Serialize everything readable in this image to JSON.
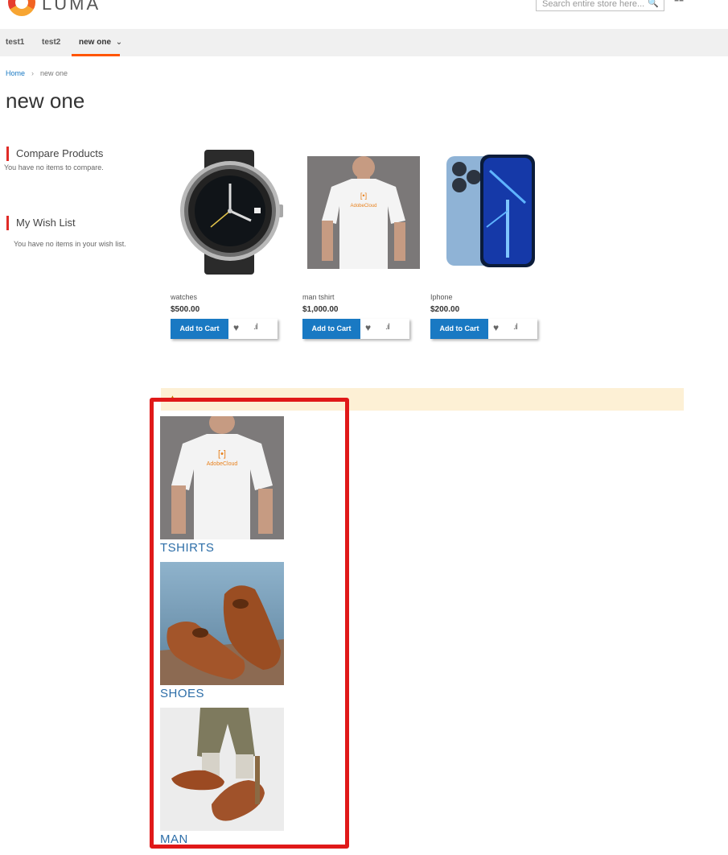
{
  "header": {
    "logo_text": "LUMA",
    "search_placeholder": "Search entire store here...",
    "minicart_icon": "cart-icon"
  },
  "nav": {
    "items": [
      "test1",
      "test2",
      "new one"
    ],
    "active_index": 2
  },
  "breadcrumb": {
    "home": "Home",
    "separator": "›",
    "current": "new one"
  },
  "page_title": "new one",
  "sidebar": {
    "compare": {
      "title": "Compare Products",
      "text": "You have no items to compare."
    },
    "wishlist": {
      "title": "My Wish List",
      "text": "You have no items in your wish list."
    }
  },
  "products": [
    {
      "name": "watches",
      "price": "$500.00",
      "button": "Add to Cart"
    },
    {
      "name": "man tshirt",
      "price": "$1,000.00",
      "button": "Add to Cart"
    },
    {
      "name": "Iphone",
      "price": "$200.00",
      "button": "Add to Cart"
    }
  ],
  "notice": {
    "icon": "warning-icon"
  },
  "categories": [
    {
      "label": "TSHIRTS"
    },
    {
      "label": "SHOES"
    },
    {
      "label": "MAN"
    }
  ],
  "colors": {
    "accent": "#1979c3",
    "nav_active": "#ff5501",
    "highlight": "#e01919",
    "notice_bg": "#fdf0d5"
  }
}
